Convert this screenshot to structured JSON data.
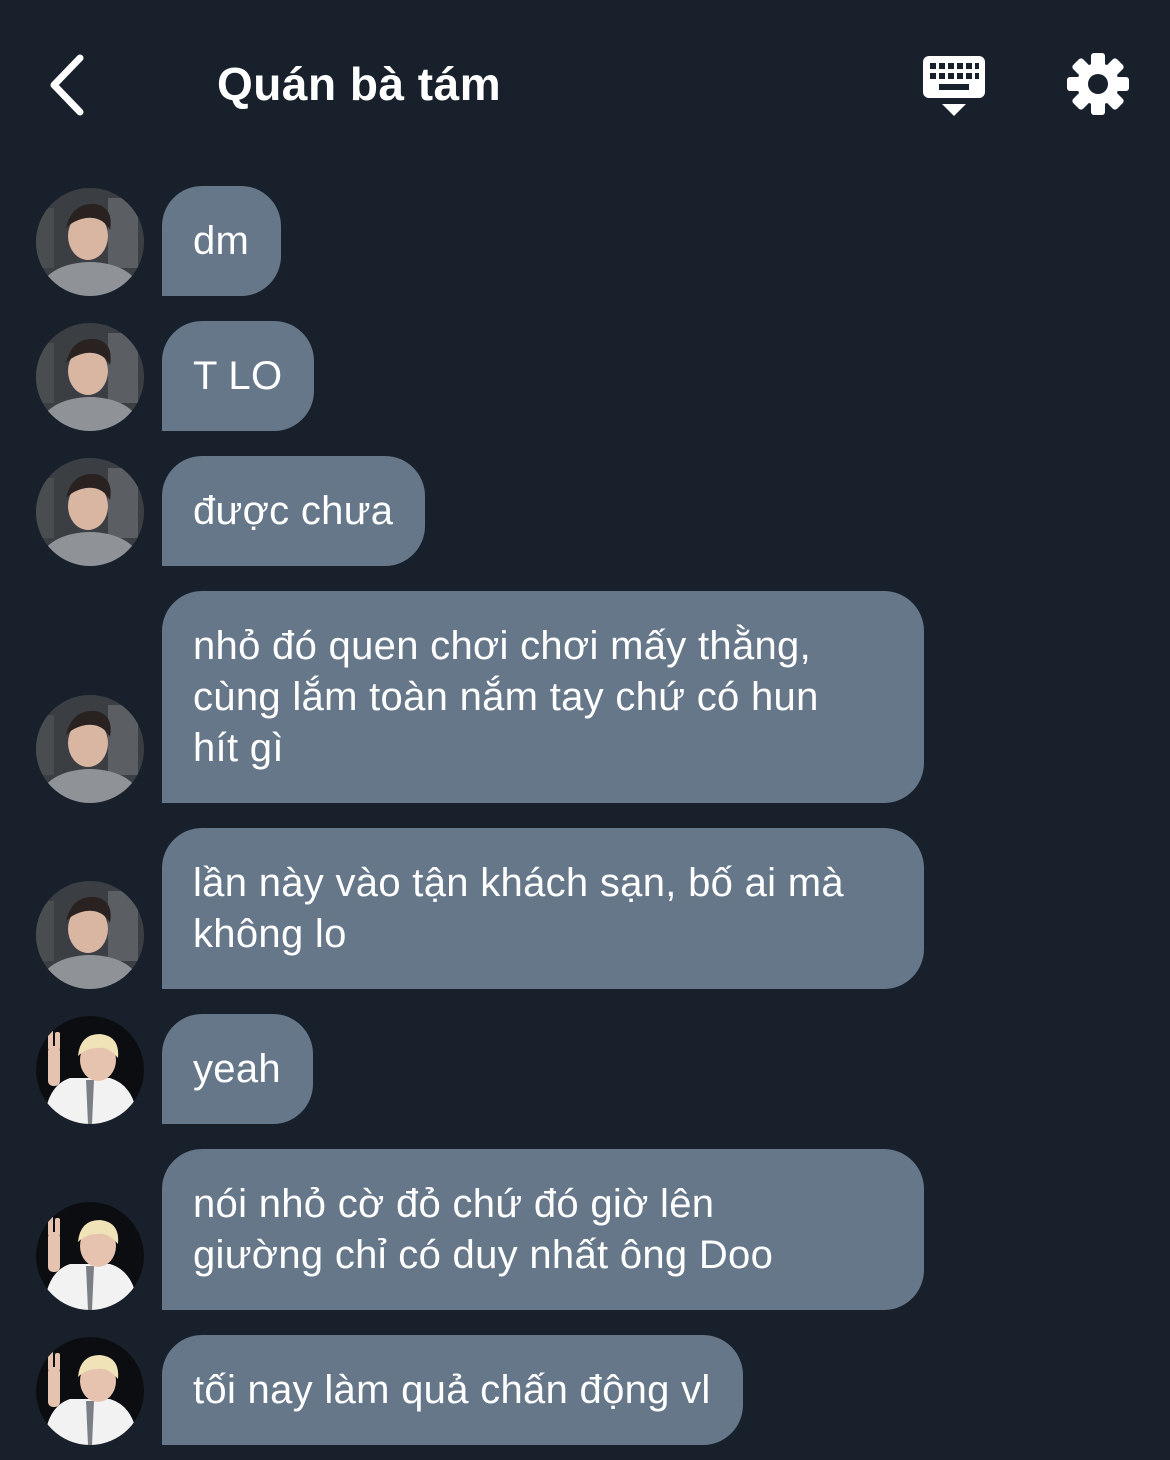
{
  "header": {
    "title": "Quán bà tám",
    "back_icon": "chevron-left-icon",
    "keyboard_icon": "keyboard-icon",
    "settings_icon": "gear-icon"
  },
  "colors": {
    "background": "#17202b",
    "bubble": "#66778a",
    "text": "#ffffff"
  },
  "messages": [
    {
      "sender": "user1",
      "text": "dm"
    },
    {
      "sender": "user1",
      "text": "T LO"
    },
    {
      "sender": "user1",
      "text": "được chưa"
    },
    {
      "sender": "user1",
      "text": "nhỏ đó quen chơi chơi mấy thằng,\ncùng lắm toàn nắm tay chứ có hun\nhít gì"
    },
    {
      "sender": "user1",
      "text": "lần này vào tận khách sạn, bố ai mà\nkhông lo"
    },
    {
      "sender": "user2",
      "text": "yeah"
    },
    {
      "sender": "user2",
      "text": "nói nhỏ cờ đỏ chứ đó giờ lên\ngiường chỉ có duy nhất ông Doo"
    },
    {
      "sender": "user2",
      "text": "tối nay làm quả chấn động vl"
    }
  ]
}
